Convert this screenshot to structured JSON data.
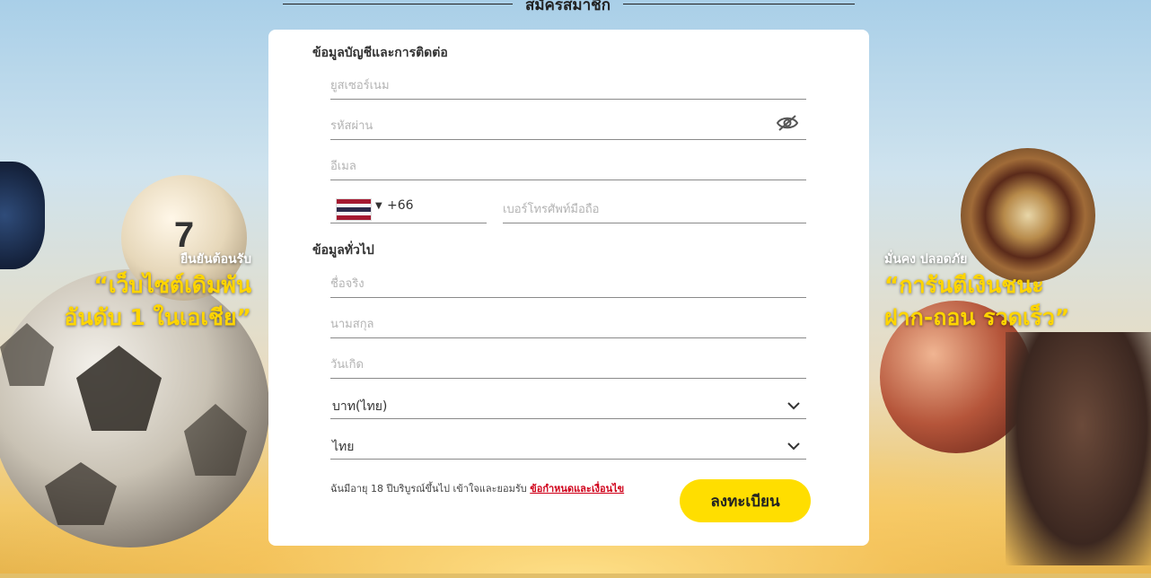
{
  "page_title": "สมัครสมาชิก",
  "promo_left": {
    "small": "ยืนยันต้อนรับ",
    "line1": "“เว็บไซต์เดิมพัน",
    "line2": "อันดับ 1 ในเอเชีย”"
  },
  "promo_right": {
    "small": "มั่นคง ปลอดภัย",
    "line1": "“การันตีเงินชนะ",
    "line2": "ฝาก-ถอน รวดเร็ว”"
  },
  "form": {
    "account_section_title": "ข้อมูลบัญชีและการติดต่อ",
    "username_placeholder": "ยูสเซอร์เนม",
    "password_placeholder": "รหัสผ่าน",
    "email_placeholder": "อีเมล",
    "phone": {
      "dial_code": "+66",
      "number_placeholder": "เบอร์โทรศัพท์มือถือ",
      "flag_icon": "thailand-flag-icon"
    },
    "general_section_title": "ข้อมูลทั่วไป",
    "first_name_placeholder": "ชื่อจริง",
    "last_name_placeholder": "นามสกุล",
    "birthdate_placeholder": "วันเกิด",
    "currency_value": "บาท(ไทย)",
    "language_value": "ไทย",
    "terms_text": "ฉันมีอายุ 18 ปีบริบูรณ์ขึ้นไป เข้าใจและยอมรับ",
    "terms_link": "ข้อกำหนดและเงื่อนไข",
    "submit_label": "ลงทะเบียน"
  },
  "colors": {
    "accent": "#ffde00",
    "promo_text": "#ffd500",
    "link": "#d0021b"
  }
}
